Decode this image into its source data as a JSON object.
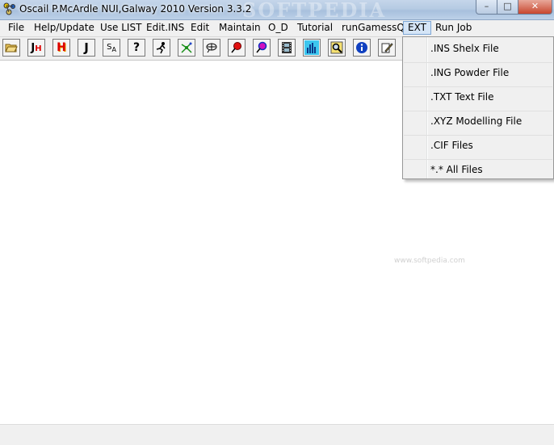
{
  "window": {
    "title": "Oscail P.McArdle NUI,Galway 2010 Version 3.3.2",
    "watermark": "SOFTPEDIA",
    "controls": {
      "minimize": "–",
      "maximize": "□",
      "close": "✕"
    }
  },
  "menubar": {
    "items": [
      "File",
      "Help/Update",
      "Use LIST",
      "Edit.INS",
      "Edit",
      "Maintain",
      "O_D",
      "Tutorial",
      "runGamessQ",
      "EXT",
      "Run Job"
    ],
    "active": "EXT"
  },
  "toolbar": {
    "buttons": [
      {
        "icon": "open-folder-icon",
        "glyph": "📂"
      },
      {
        "icon": "jh-icon",
        "glyph": "JH"
      },
      {
        "icon": "hydrogen-icon",
        "glyph": "H"
      },
      {
        "icon": "j-icon",
        "glyph": "J"
      },
      {
        "icon": "sa-icon",
        "glyph": "SA"
      },
      {
        "icon": "help-icon",
        "glyph": "?"
      },
      {
        "icon": "runner-icon",
        "glyph": "🏃"
      },
      {
        "icon": "network-icon",
        "glyph": "⚙"
      },
      {
        "icon": "molecule-icon",
        "glyph": "⛁"
      },
      {
        "icon": "pin-red-icon",
        "glyph": "●"
      },
      {
        "icon": "pin-blue-icon",
        "glyph": "●"
      },
      {
        "icon": "film-icon",
        "glyph": "🎞"
      },
      {
        "icon": "histogram-icon",
        "glyph": "▆"
      },
      {
        "icon": "image-search-icon",
        "glyph": "🔍"
      },
      {
        "icon": "info-icon",
        "glyph": "i"
      },
      {
        "icon": "edit-icon",
        "glyph": "✎"
      }
    ]
  },
  "dropdown": {
    "items": [
      ".INS Shelx File",
      ".ING Powder File",
      ".TXT Text File",
      ".XYZ Modelling File",
      ".CIF Files",
      "*.* All Files"
    ]
  },
  "footer": {
    "site_mark": "www.softpedia.com"
  }
}
